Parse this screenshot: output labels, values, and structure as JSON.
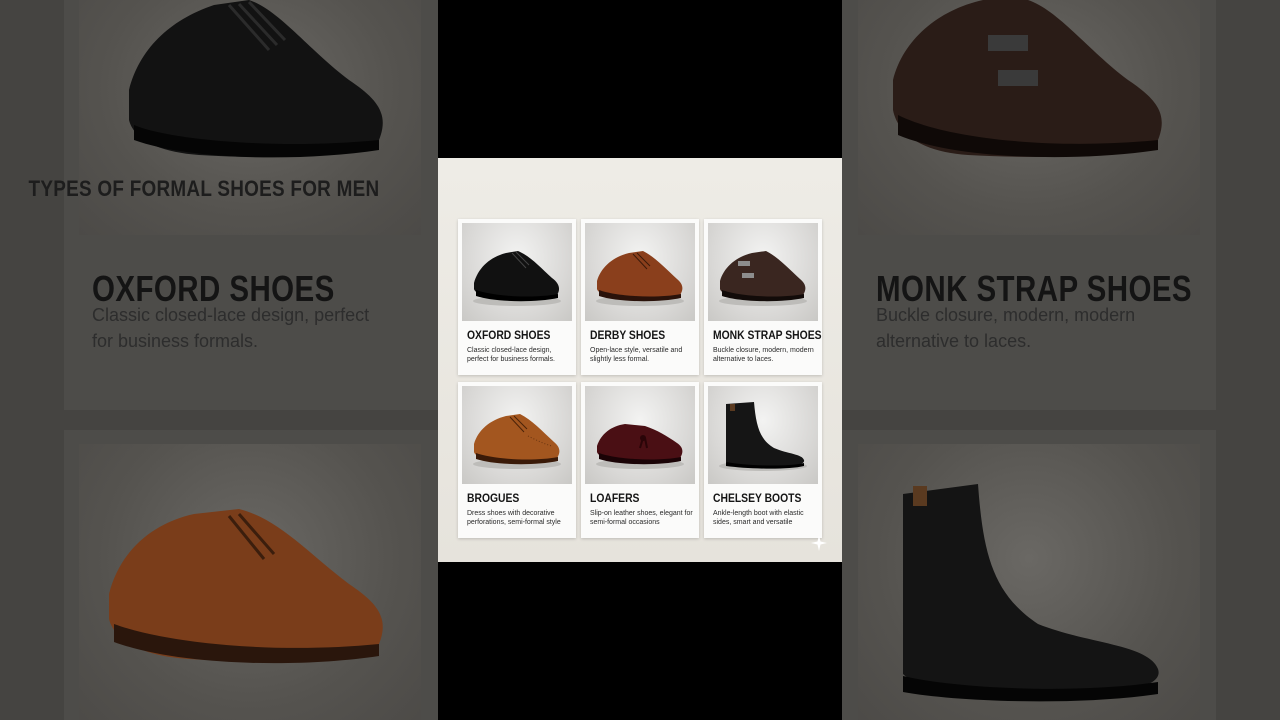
{
  "infographic": {
    "title": "TYPES OF FORMAL SHOES FOR MEN",
    "cards": [
      {
        "name": "OXFORD SHOES",
        "desc": "Classic closed-lace design, perfect for business formals.",
        "color": "#111111"
      },
      {
        "name": "DERBY SHOES",
        "desc": "Open-lace style, versatile and slightly less formal.",
        "color": "#8a3f1c"
      },
      {
        "name": "MONK STRAP SHOES",
        "desc": "Buckle closure, modern, modern alternative to laces.",
        "color": "#3a2620"
      },
      {
        "name": "BROGUES",
        "desc": "Dress shoes with decorative perforations, semi-formal style",
        "color": "#a3561f"
      },
      {
        "name": "LOAFERS",
        "desc": "Slip-on leather shoes, elegant for semi-formal occasions",
        "color": "#4a0f14"
      },
      {
        "name": "CHELSEY BOOTS",
        "desc": "Ankle-length boot with elastic sides, smart and versatile",
        "color": "#151515"
      }
    ]
  },
  "background": {
    "left_top": {
      "name": "OXFORD SHOES",
      "desc": "Classic closed-lace design, perfect for business formals."
    },
    "right_top": {
      "name": "MONK STRAP SHOES",
      "desc": "Buckle closure, modern, modern alternative to laces."
    }
  }
}
